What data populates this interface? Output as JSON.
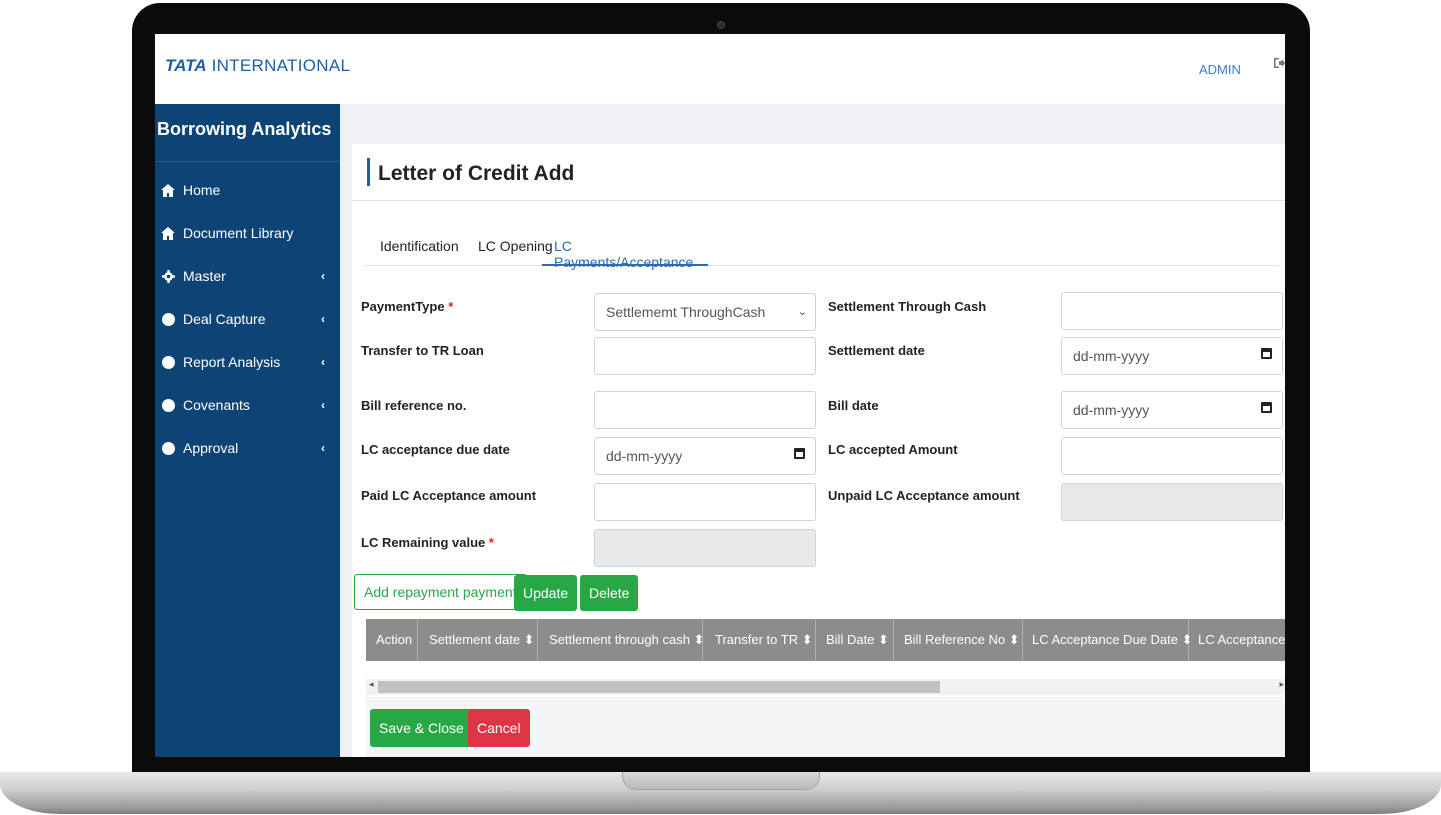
{
  "header": {
    "logo_bold": "TATA",
    "logo_rest": " INTERNATIONAL",
    "user": "ADMIN",
    "logout_icon": "sign-out-icon"
  },
  "sidebar": {
    "title": "Borrowing Analytics",
    "items": [
      {
        "label": "Home",
        "icon": "home-icon"
      },
      {
        "label": "Document Library",
        "icon": "home-icon"
      },
      {
        "label": "Master",
        "icon": "gear-icon",
        "expandable": true
      },
      {
        "label": "Deal Capture",
        "icon": "circle-icon",
        "expandable": true
      },
      {
        "label": "Report Analysis",
        "icon": "circle-icon",
        "expandable": true
      },
      {
        "label": "Covenants",
        "icon": "circle-icon",
        "expandable": true
      },
      {
        "label": "Approval",
        "icon": "circle-icon",
        "expandable": true
      }
    ],
    "chevron": "‹"
  },
  "page": {
    "title": "Letter of Credit Add",
    "tabs": [
      "Identification",
      "LC Opening",
      "LC Payments/Acceptance"
    ],
    "active_tab": "LC Payments/Acceptance"
  },
  "form": {
    "payment_type": {
      "label": "PaymentType",
      "required": "*",
      "value": "Settlememt ThroughCash"
    },
    "settlement_through_cash": {
      "label": "Settlement Through Cash",
      "value": ""
    },
    "transfer_to_tr_loan": {
      "label": "Transfer to TR Loan",
      "value": ""
    },
    "settlement_date": {
      "label": "Settlement date",
      "placeholder": "dd-mm-yyyy"
    },
    "bill_reference_no": {
      "label": "Bill reference no.",
      "value": ""
    },
    "bill_date": {
      "label": "Bill date",
      "placeholder": "dd-mm-yyyy"
    },
    "lc_acceptance_due_date": {
      "label": "LC acceptance due date",
      "placeholder": "dd-mm-yyyy"
    },
    "lc_accepted_amount": {
      "label": "LC accepted Amount",
      "value": ""
    },
    "paid_lc_acceptance_amount": {
      "label": "Paid LC Acceptance amount",
      "value": ""
    },
    "unpaid_lc_acceptance_amount": {
      "label": "Unpaid LC Acceptance amount",
      "value": ""
    },
    "lc_remaining_value": {
      "label": "LC Remaining value",
      "required": "*",
      "value": ""
    }
  },
  "actions": {
    "add": "Add repayment payment",
    "update": "Update",
    "delete": "Delete",
    "save_close": "Save & Close",
    "cancel": "Cancel"
  },
  "table": {
    "sort_icon": "⬍",
    "columns": [
      "Action",
      "Settlement date ⬍",
      "Settlement through cash ⬍",
      "Transfer to TR ⬍",
      "Bill Date ⬍",
      "Bill Reference No ⬍",
      "LC Acceptance Due Date ⬍",
      "LC Acceptance A"
    ]
  },
  "colors": {
    "sidebar": "#0d4475",
    "accent": "#1b5fa8",
    "success": "#28a745",
    "danger": "#dc3545"
  }
}
